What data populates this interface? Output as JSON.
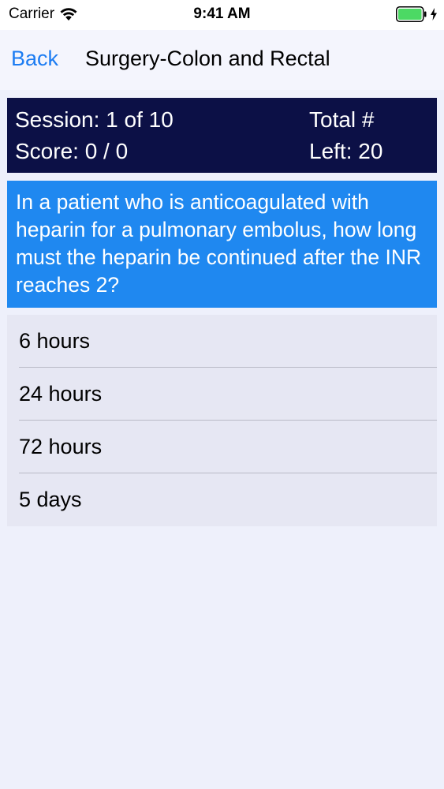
{
  "status_bar": {
    "carrier": "Carrier",
    "time": "9:41 AM",
    "battery_color": "#4cd964"
  },
  "nav": {
    "back_label": "Back",
    "title": "Surgery-Colon and Rectal"
  },
  "session": {
    "session_text": "Session: 1 of 10",
    "score_text": "Score: 0 / 0",
    "total_text": "Total #",
    "left_text": "Left: 20"
  },
  "question": {
    "text": "In a patient who is anticoagulated with heparin for a pulmonary embolus, how long must the heparin be continued after the INR reaches 2?"
  },
  "answers": [
    {
      "label": "6 hours"
    },
    {
      "label": "24 hours"
    },
    {
      "label": "72 hours"
    },
    {
      "label": "5 days"
    }
  ],
  "colors": {
    "accent": "#1c7cf2",
    "header_panel": "#0c1046",
    "question_bg": "#1f88f0",
    "answers_bg": "#e6e7f3"
  }
}
